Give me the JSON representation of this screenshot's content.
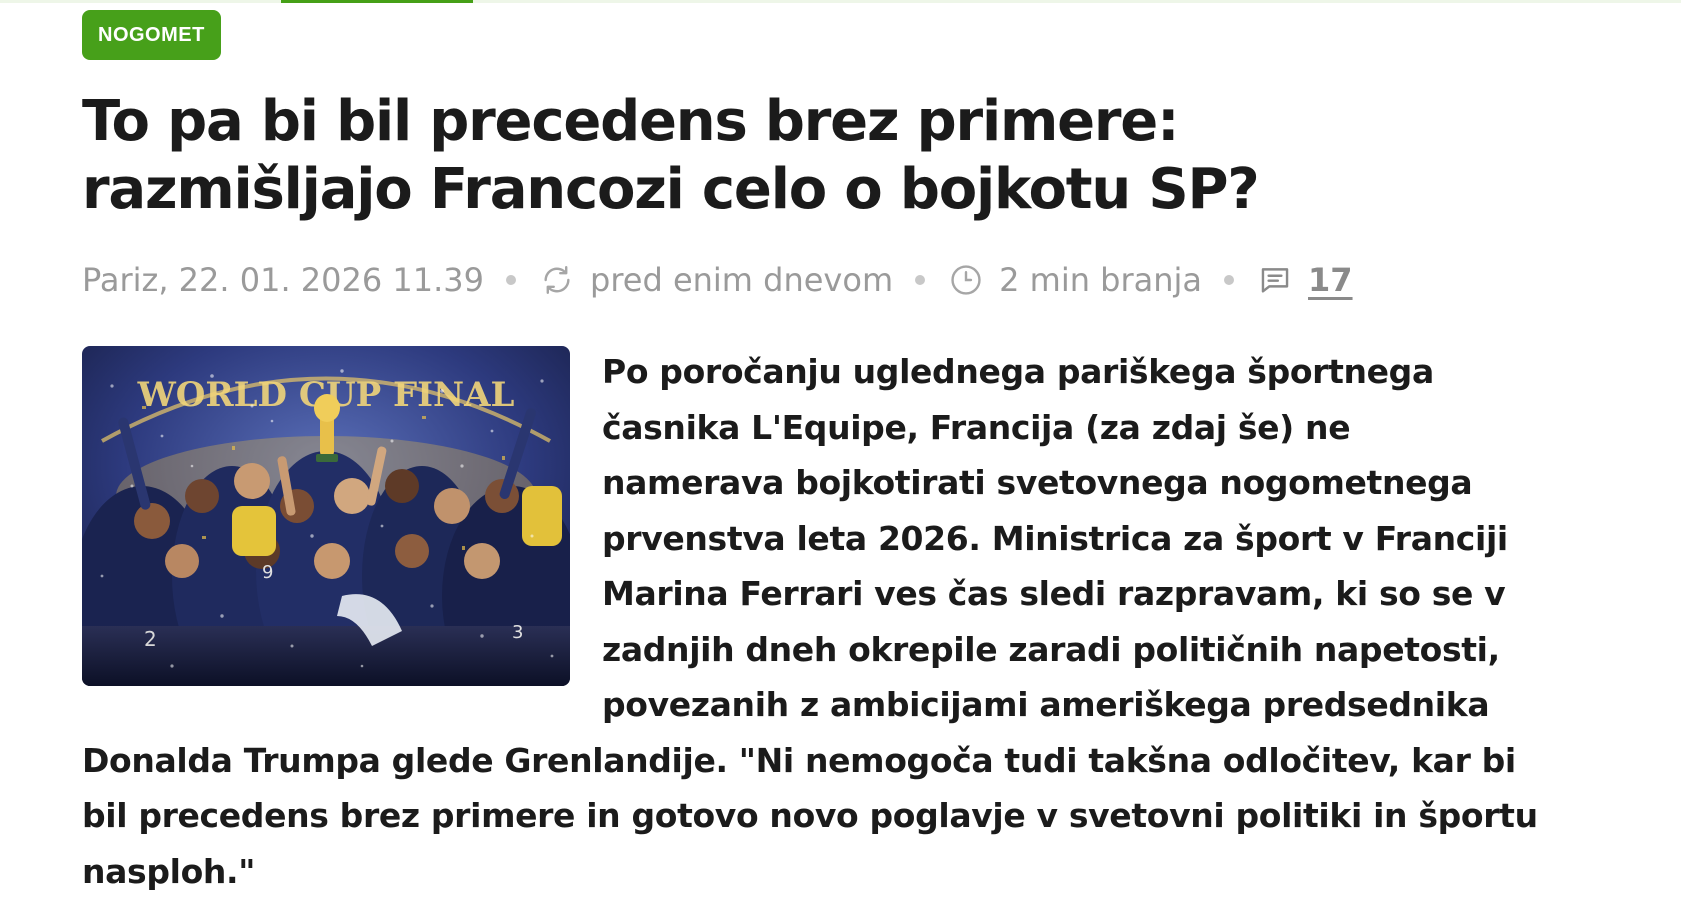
{
  "category": {
    "label": "NOGOMET"
  },
  "article": {
    "title": "To pa bi bil precedens brez primere: razmišljajo Francozi celo o bojkotu SP?",
    "meta": {
      "location_date": "Pariz, 22. 01. 2026 11.39",
      "updated": "pred enim dnevom",
      "read_time": "2 min branja",
      "comment_count": "17",
      "icons": {
        "updated": "refresh-icon",
        "read_time": "clock-icon",
        "comments": "comment-icon"
      }
    },
    "image": {
      "caption_text": "WORLD CUP FINAL"
    },
    "lead": "Po poročanju uglednega pariškega športnega časnika L'Equipe, Francija (za zdaj še) ne namerava bojkotirati svetovnega nogometnega prvenstva leta 2026. Ministrica za šport v Franciji Marina Ferrari ves čas sledi razpravam, ki so se v zadnjih dneh okrepile zaradi političnih napetosti, povezanih z ambicijami ameriškega predsednika Donalda Trumpa glede Grenlandije. \"Ni nemogoča tudi takšna odločitev, kar bi bil precedens brez primere in gotovo novo poglavje v svetovni politiki in športu nasploh.\""
  },
  "colors": {
    "accent": "#47a01a",
    "meta_text": "#9a9a9a",
    "title": "#1b1b1b"
  }
}
